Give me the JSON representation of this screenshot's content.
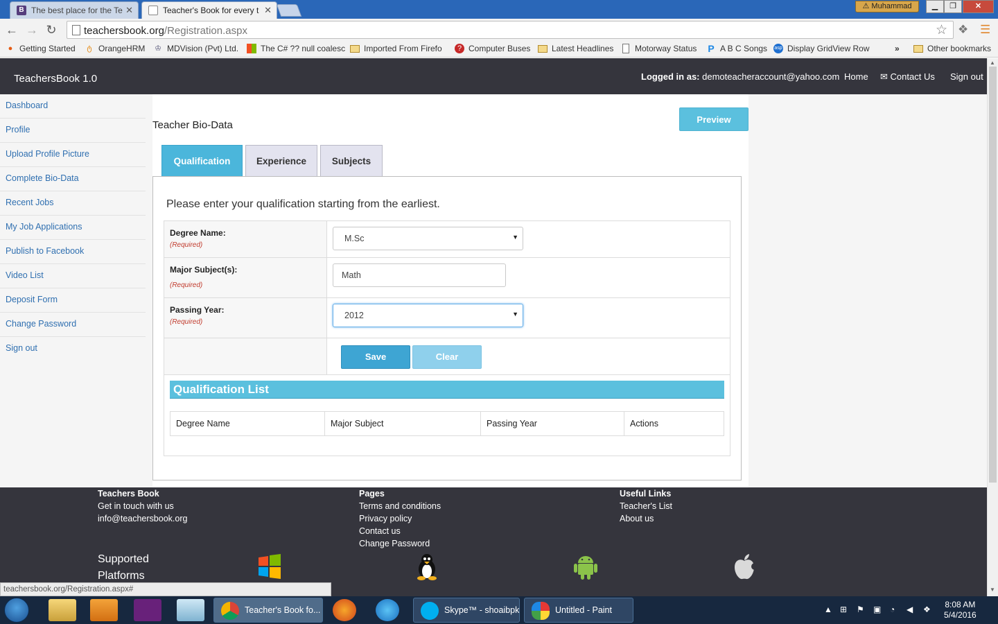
{
  "browser": {
    "tabs": [
      {
        "label": "The best place for the Te",
        "favicon": "B"
      },
      {
        "label": "Teacher's Book for every t",
        "favicon": ""
      }
    ],
    "profile_name": "Muhammad",
    "url_host": "teachersbook.org",
    "url_path": "/Registration.aspx",
    "bookmarks": [
      "Getting Started",
      "OrangeHRM",
      "MDVision (Pvt) Ltd.",
      "The C# ?? null coalesc",
      "Imported From Firefo",
      "Computer Buses",
      "Latest Headlines",
      "Motorway Status",
      "A B C Songs",
      "Display GridView Row",
      "Other bookmarks"
    ],
    "overflow_chevron": "»",
    "status_url": "teachersbook.org/Registration.aspx#"
  },
  "navbar": {
    "brand": "TeachersBook 1.0",
    "logged_in_prefix": "Logged in as:",
    "user_email": "demoteacheraccount@yahoo.com",
    "home": "Home",
    "contact": "Contact Us",
    "signout": "Sign out"
  },
  "sidebar": {
    "items": [
      "Dashboard",
      "Profile",
      "Upload Profile Picture",
      "Complete Bio-Data",
      "Recent Jobs",
      "My Job Applications",
      "Publish to Facebook",
      "Video List",
      "Deposit Form",
      "Change Password",
      "Sign out"
    ]
  },
  "main": {
    "heading": "Teacher Bio-Data",
    "preview_label": "Preview",
    "tabs": [
      "Qualification",
      "Experience",
      "Subjects"
    ],
    "intro": "Please enter your qualification starting from the earliest.",
    "form": {
      "degree_label": "Degree Name:",
      "degree_value": "M.Sc",
      "major_label": "Major Subject(s):",
      "major_value": "Math",
      "year_label": "Passing Year:",
      "year_value": "2012",
      "required": "(Required)",
      "save_label": "Save",
      "clear_label": "Clear"
    },
    "qualification_list": {
      "title": "Qualification List",
      "columns": [
        "Degree Name",
        "Major Subject",
        "Passing Year",
        "Actions"
      ]
    }
  },
  "footer": {
    "col1": {
      "title": "Teachers Book",
      "lines": [
        "Get in touch with us",
        "info@teachersbook.org"
      ]
    },
    "col2": {
      "title": "Pages",
      "lines": [
        "Terms and conditions",
        "Privacy policy",
        "Contact us",
        "Change Password"
      ]
    },
    "col3": {
      "title": "Useful Links",
      "lines": [
        "Teacher's List",
        "About us"
      ]
    },
    "platforms_title_1": "Supported",
    "platforms_title_2": "Platforms",
    "platform_icons": [
      "windows-icon",
      "linux-icon",
      "android-icon",
      "apple-icon"
    ]
  },
  "taskbar": {
    "apps": [
      {
        "label": "Teacher's Book fo...",
        "icon": "chrome-icon"
      },
      {
        "label": "Skype™ - shoaibpk",
        "icon": "skype-icon"
      },
      {
        "label": "Untitled - Paint",
        "icon": "paint-icon"
      }
    ],
    "time": "8:08 AM",
    "date": "5/4/2016"
  },
  "colors": {
    "navbar_bg": "#35353d",
    "accent": "#5bc0de",
    "save_btn": "#3ea5d3",
    "link": "#2f6fb0",
    "required": "#c0392b"
  }
}
